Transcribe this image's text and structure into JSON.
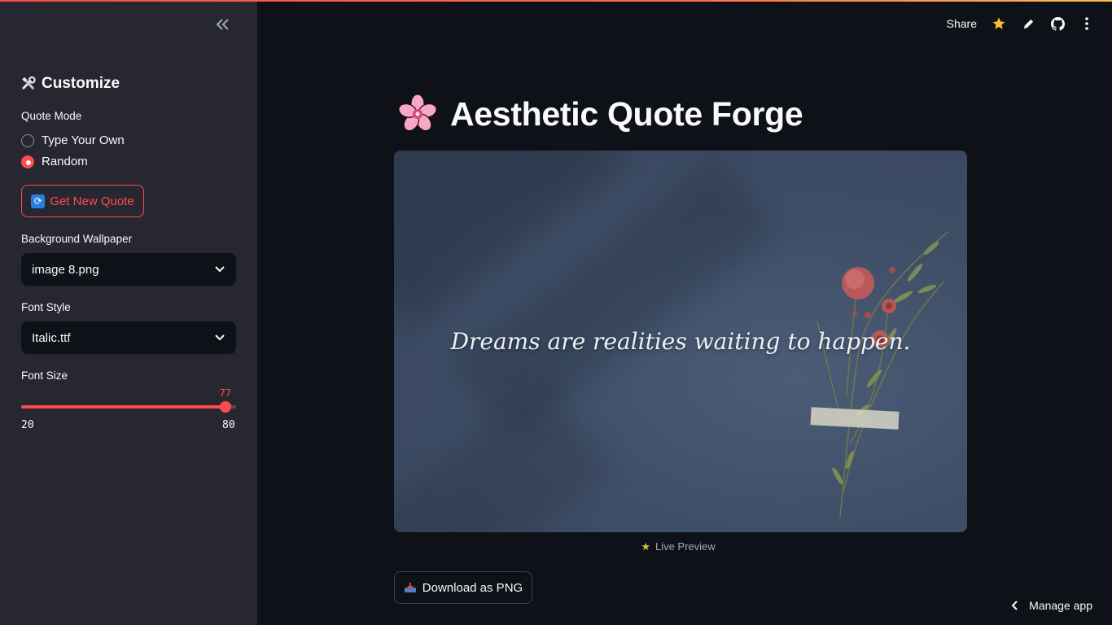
{
  "sidebar": {
    "title": "Customize",
    "quote_mode_label": "Quote Mode",
    "quote_mode_options": [
      "Type Your Own",
      "Random"
    ],
    "quote_mode_selected": "Random",
    "new_quote_label": "Get New Quote",
    "background_label": "Background Wallpaper",
    "background_value": "image 8.png",
    "font_style_label": "Font Style",
    "font_style_value": "Italic.ttf",
    "font_size_label": "Font Size",
    "font_size": {
      "value": "77",
      "min": "20",
      "max": "80"
    }
  },
  "header": {
    "share_label": "Share"
  },
  "main": {
    "title": "Aesthetic Quote Forge",
    "quote": "Dreams are realities waiting to happen.",
    "caption": "Live Preview",
    "download_label": "Download as PNG"
  },
  "footer": {
    "manage_label": "Manage app"
  },
  "colors": {
    "accent": "#ff4b4b",
    "background": "#0e1117",
    "sidebar": "#262730"
  }
}
